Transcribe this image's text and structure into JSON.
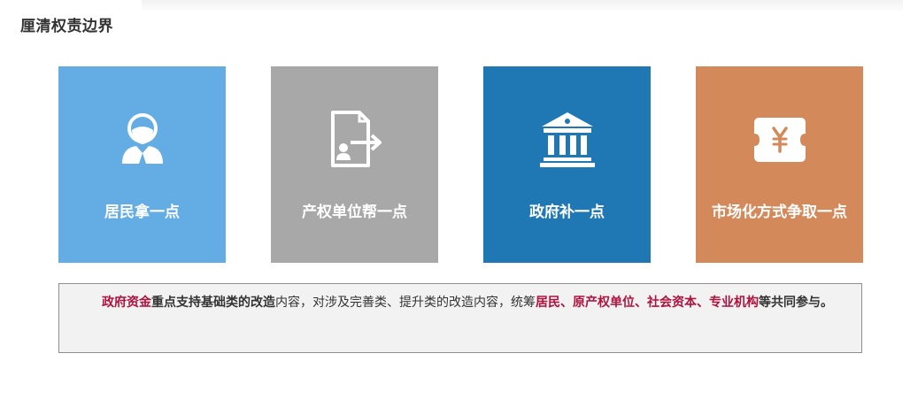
{
  "page": {
    "title": "厘清权责边界"
  },
  "cards": [
    {
      "label": "居民拿一点",
      "icon": "resident-person-icon",
      "color": "#63ade4"
    },
    {
      "label": "产权单位帮一点",
      "icon": "document-transfer-icon",
      "color": "#a8a8a8"
    },
    {
      "label": "政府补一点",
      "icon": "government-building-icon",
      "color": "#1f78b3"
    },
    {
      "label": "市场化方式争取一点",
      "icon": "yuan-ticket-icon",
      "color": "#d4895a"
    }
  ],
  "note": {
    "seg1": "政府资金",
    "seg2": "重点支持基础类的改造",
    "seg3": "内容，对涉及完善类、提升类的改造内容，统筹",
    "seg4": "居民、原产权单位、社会资本、专业机构",
    "seg5": "等共同参与。"
  },
  "colors": {
    "highlight": "#b0123f",
    "note_background": "#f2f2f2",
    "note_border": "#8f8f8f"
  }
}
